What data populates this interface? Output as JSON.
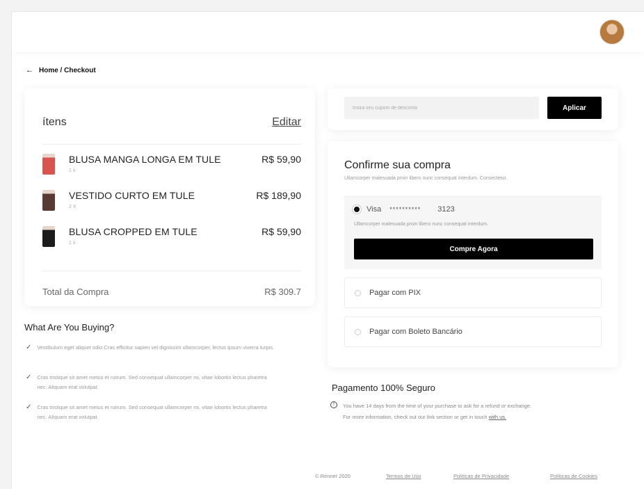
{
  "breadcrumb": {
    "text": "Home / Checkout"
  },
  "items_card": {
    "title": "ítens",
    "edit_label": "Editar",
    "items": [
      {
        "name": "BLUSA MANGA LONGA EM TULE",
        "qty": "1 x",
        "price": "R$ 59,90",
        "thumb_color": "#d9534f"
      },
      {
        "name": "VESTIDO CURTO EM TULE",
        "qty": "2 X",
        "price": "R$ 189,90",
        "thumb_color": "#5a3b33"
      },
      {
        "name": "BLUSA CROPPED EM TULE",
        "qty": "1 x",
        "price": "R$ 59,90",
        "thumb_color": "#1c1c1c"
      }
    ],
    "total_label": "Total da Compra",
    "total_value": "R$ 309.7"
  },
  "buying": {
    "title": "What Are You Buying?",
    "items": [
      "Vestibulum eget aliquet odio Cras efficitur sapien vel dignissim ullamcorper, lectus ipsum viverra turpis.",
      "Cras tristique sit amet metus et rutrum. Sed consequat ullamcorper mi, vitae lobortis lectus pharetra nec. Aliquam erat volutpat.",
      "Cras tristique sit amet metus et rutrum. Sed consequat ullamcorper mi, vitae lobortis lectus pharetra nec. Aliquam erat volutpat."
    ]
  },
  "coupon": {
    "placeholder": "Insira seu cupom de desconto",
    "button_label": "Aplicar"
  },
  "confirm": {
    "title": "Confirme sua compra",
    "subtitle": "Ullamcorper malesuada proin libero nunc consequat interdum. Consectetur.",
    "visa_label": "Visa",
    "visa_mask": "**********",
    "visa_last": "3123",
    "visa_desc": "Ullamcorper malesuada proin libero nunc consequat interdum.",
    "buy_button": "Compre Agora",
    "options": [
      "Pagar com PIX",
      "Pagar com Boleto Bancário"
    ]
  },
  "secure": {
    "title": "Pagamento 100% Seguro",
    "text_line1": "You have 14 days from the time of your purchase to ask for a refund or exchange.",
    "text_line2": "For more information, check out our link section or get in touch",
    "link": "with us."
  },
  "footer": {
    "copyright": "© Renner 2020",
    "terms": "Termos de Uso",
    "privacy": "Políticas de Privacidade",
    "cookies": "Políticas de Cookies"
  }
}
